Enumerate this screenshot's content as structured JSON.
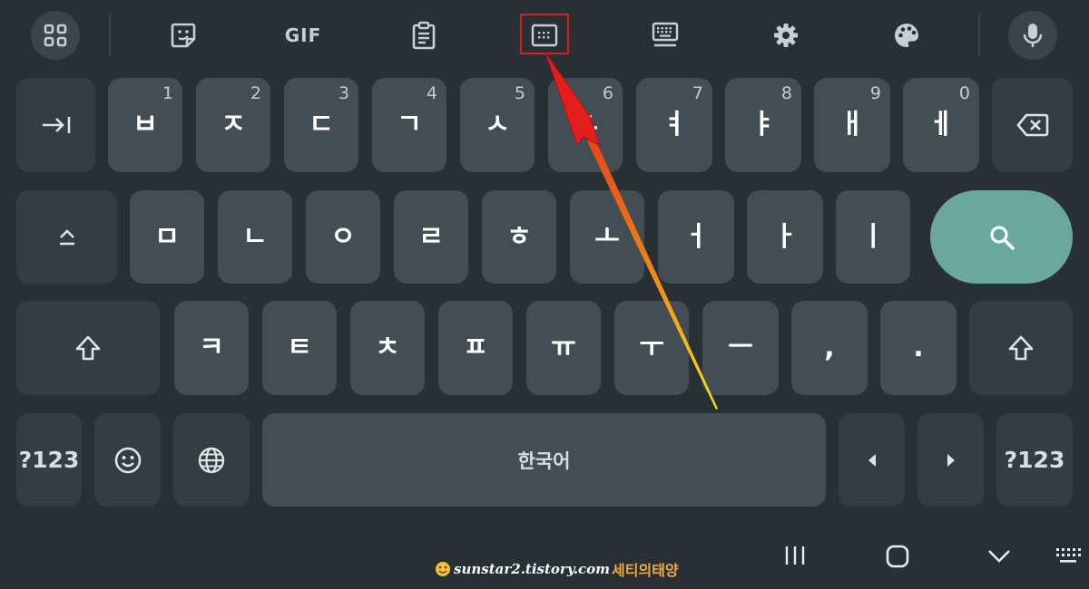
{
  "toolbar": {
    "items": [
      {
        "name": "apps-grid-icon"
      },
      {
        "name": "sticker-icon"
      },
      {
        "name": "gif-button",
        "label": "GIF"
      },
      {
        "name": "clipboard-icon"
      },
      {
        "name": "one-handed-keyboard-icon",
        "highlighted": true
      },
      {
        "name": "keyboard-resize-icon"
      },
      {
        "name": "settings-gear-icon"
      },
      {
        "name": "theme-palette-icon"
      },
      {
        "name": "microphone-icon"
      }
    ],
    "highlight_color": "#e01b1b"
  },
  "rows": {
    "row1": {
      "tab_icon": "tab-icon",
      "keys": [
        {
          "char": "ㅂ",
          "num": "1"
        },
        {
          "char": "ㅈ",
          "num": "2"
        },
        {
          "char": "ㄷ",
          "num": "3"
        },
        {
          "char": "ㄱ",
          "num": "4"
        },
        {
          "char": "ㅅ",
          "num": "5"
        },
        {
          "char": "ㅛ",
          "num": "6"
        },
        {
          "char": "ㅕ",
          "num": "7"
        },
        {
          "char": "ㅑ",
          "num": "8"
        },
        {
          "char": "ㅐ",
          "num": "9"
        },
        {
          "char": "ㅔ",
          "num": "0"
        }
      ],
      "backspace_icon": "backspace-icon"
    },
    "row2": {
      "hide_icon": "caps-up-icon",
      "keys": [
        "ㅁ",
        "ㄴ",
        "ㅇ",
        "ㄹ",
        "ㅎ",
        "ㅗ",
        "ㅓ",
        "ㅏ",
        "ㅣ"
      ],
      "search_icon": "search-icon"
    },
    "row3": {
      "keys": [
        "ㅋ",
        "ㅌ",
        "ㅊ",
        "ㅍ",
        "ㅠ",
        "ㅜ",
        "ㅡ",
        ",",
        "."
      ]
    },
    "row4": {
      "symbols_left": "?123",
      "space_label": "한국어",
      "symbols_right": "?123"
    }
  },
  "colors": {
    "background": "#283036",
    "key": "#434e54",
    "function_key": "#333d42",
    "accent": "#6aa79d",
    "arrow": "#e01b1b"
  },
  "watermark": {
    "site": "sunstar2.tistory.com",
    "name": "세티의태양"
  }
}
